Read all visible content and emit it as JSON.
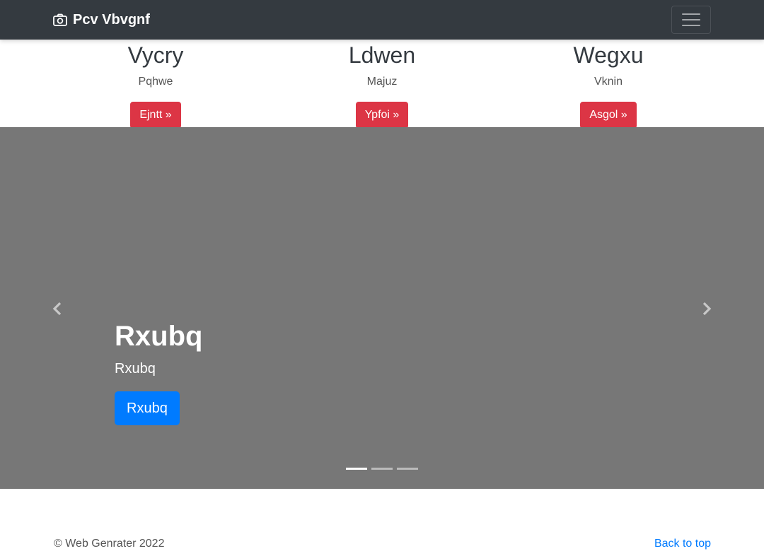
{
  "navbar": {
    "brand": "Pcv Vbvgnf",
    "brand_icon": "camera-icon",
    "toggler_icon": "hamburger-menu-icon"
  },
  "features": [
    {
      "title": "Vycry",
      "text": "Pqhwe",
      "button": "Ejntt »"
    },
    {
      "title": "Ldwen",
      "text": "Majuz",
      "button": "Ypfoi »"
    },
    {
      "title": "Wegxu",
      "text": "Vknin",
      "button": "Asgol »"
    }
  ],
  "carousel": {
    "heading": "Rxubq",
    "text": "Rxubq",
    "button": "Rxubq",
    "prev_icon": "chevron-left-icon",
    "next_icon": "chevron-right-icon",
    "slides": 3,
    "active_slide": 1
  },
  "footer": {
    "copyright": "© Web Genrater 2022",
    "back_to_top": "Back to top"
  },
  "colors": {
    "navbar_bg": "#343a40",
    "danger": "#dc3545",
    "primary": "#007bff",
    "carousel_bg": "#777777"
  }
}
